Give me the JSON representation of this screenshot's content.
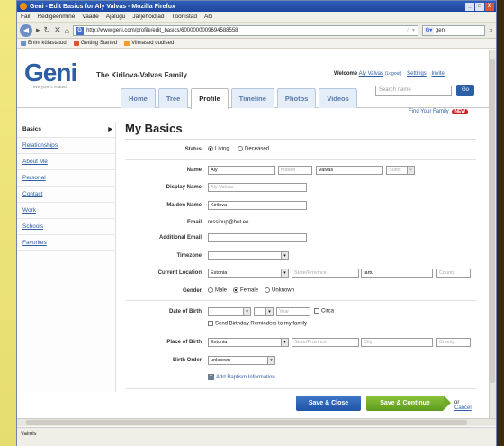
{
  "browser": {
    "title": "Geni - Edit Basics for Aly Valvas - Mozilla Firefox",
    "menu": [
      "Fail",
      "Redigeerimine",
      "Vaade",
      "Ajalugu",
      "Järjehoidjad",
      "Tööriistad",
      "Abi"
    ],
    "url": "http://www.geni.com/profile/edit_basics/6000000009694588558",
    "search": "geni",
    "bookmarks": [
      "Enim külastatud",
      "Getting Started",
      "Viimased uudised"
    ],
    "status": "Valmis",
    "window_controls": [
      "_",
      "□",
      "X"
    ]
  },
  "header": {
    "logo": "Geni",
    "tagline": "everyone's related",
    "family": "The Kirilova-Valvas Family",
    "welcome_prefix": "Welcome",
    "user": "Aly Valvas",
    "logout": "(Logout)",
    "settings": "Settings",
    "invite": "Invite",
    "search_placeholder": "Search name",
    "go": "Go",
    "find_family": "Find Your Family",
    "new_badge": "NEW"
  },
  "tabs": [
    "Home",
    "Tree",
    "Profile",
    "Timeline",
    "Photos",
    "Videos"
  ],
  "sidebar": [
    "Basics",
    "Relationships",
    "About Me",
    "Personal",
    "Contact",
    "Work",
    "Schools",
    "Favorites"
  ],
  "form": {
    "title": "My Basics",
    "status_label": "Status",
    "status_options": [
      "Living",
      "Deceased"
    ],
    "name_label": "Name",
    "first_name": "Aly",
    "middle_placeholder": "Middle",
    "last_name": "Valvas",
    "suffix_placeholder": "Suffix",
    "display_name_label": "Display Name",
    "display_name": "Aly Valvas",
    "maiden_name_label": "Maiden Name",
    "maiden_name": "Kirilova",
    "email_label": "Email",
    "email": "rossihup@hot.ee",
    "additional_email_label": "Additional Email",
    "timezone_label": "Timezone",
    "current_location_label": "Current Location",
    "current_country": "Estonia",
    "state_placeholder": "State/Province",
    "current_city": "tartu",
    "county_placeholder": "County",
    "gender_label": "Gender",
    "gender_options": [
      "Male",
      "Female",
      "Unknown"
    ],
    "dob_label": "Date of Birth",
    "year_placeholder": "Year",
    "circa": "Circa",
    "reminder": "Send Birthday Reminders to my family",
    "pob_label": "Place of Birth",
    "birth_country": "Estonia",
    "city_placeholder": "City",
    "birth_order_label": "Birth Order",
    "birth_order": "unknown",
    "add_baptism": "Add Baptism Information",
    "save_close": "Save & Close",
    "save_continue": "Save & Continue",
    "or": "or",
    "cancel": "Cancel"
  }
}
